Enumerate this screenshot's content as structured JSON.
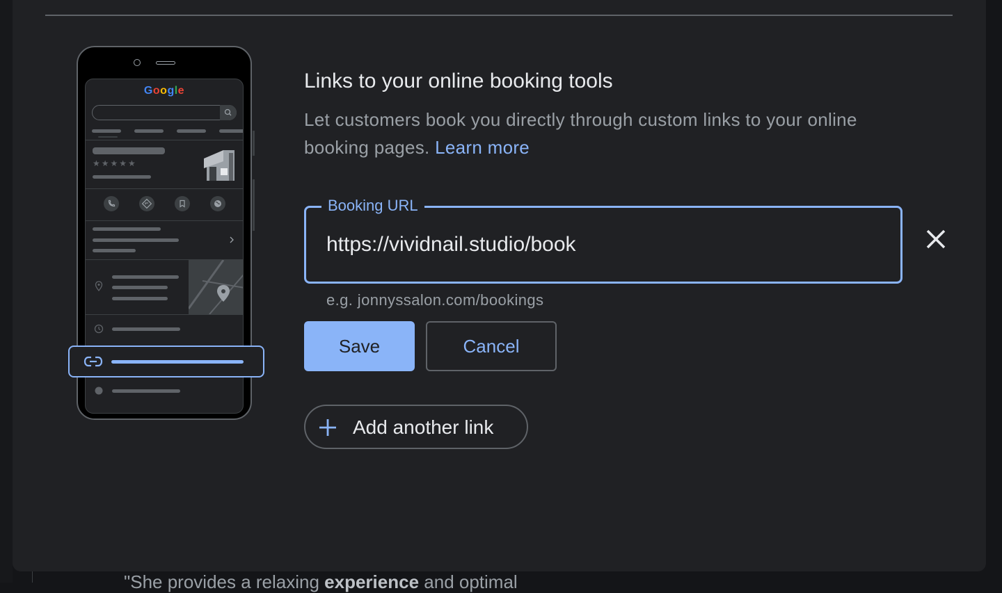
{
  "background": {
    "text_prefix": "\"She provides a relaxing ",
    "text_bold": "experience",
    "text_suffix": " and optimal"
  },
  "illustration": {
    "google_logo": [
      "G",
      "o",
      "o",
      "g",
      "l",
      "e"
    ],
    "google_colors": [
      "#4285f4",
      "#ea4335",
      "#fbbc05",
      "#4285f4",
      "#34a853",
      "#ea4335"
    ],
    "stars": "★★★★★"
  },
  "section": {
    "title": "Links to your online booking tools",
    "description": "Let customers book you directly through custom links to your online booking pages. ",
    "learn_more": "Learn more"
  },
  "booking_field": {
    "label": "Booking URL",
    "value": "https://vividnail.studio/book",
    "hint": "e.g. jonnyssalon.com/bookings"
  },
  "actions": {
    "save": "Save",
    "cancel": "Cancel",
    "add_another": "Add another link"
  },
  "colors": {
    "accent": "#8ab4f8",
    "dialog_bg": "#202124",
    "border": "#5f6368"
  }
}
